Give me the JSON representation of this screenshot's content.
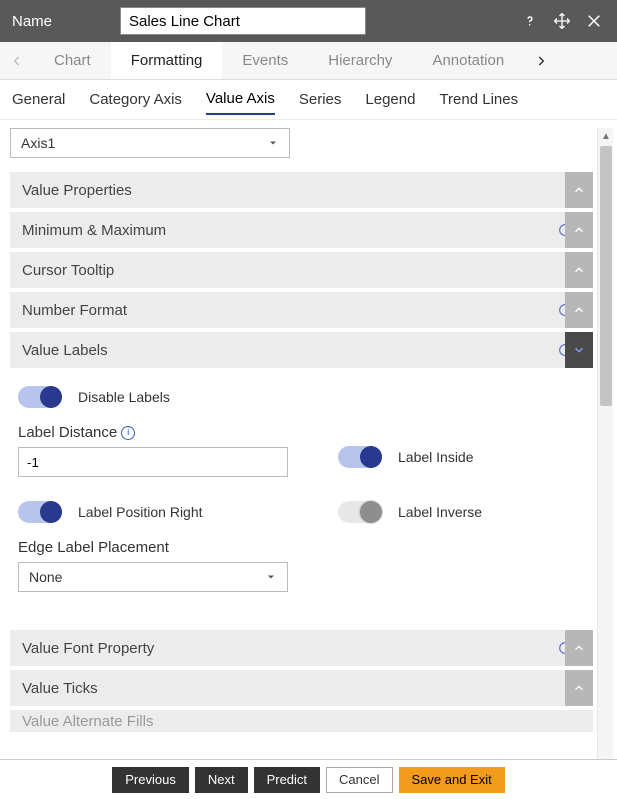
{
  "header": {
    "name_label": "Name",
    "name_value": "Sales Line Chart"
  },
  "primary_tabs": {
    "items": [
      "Chart",
      "Formatting",
      "Events",
      "Hierarchy",
      "Annotation"
    ],
    "active_index": 1
  },
  "sub_tabs": {
    "items": [
      "General",
      "Category Axis",
      "Value Axis",
      "Series",
      "Legend",
      "Trend Lines"
    ],
    "active_index": 2
  },
  "axis_select": {
    "value": "Axis1"
  },
  "accordions": {
    "value_properties": {
      "label": "Value Properties",
      "has_refresh": false,
      "expanded": false
    },
    "minimum_maximum": {
      "label": "Minimum & Maximum",
      "has_refresh": true,
      "expanded": false
    },
    "cursor_tooltip": {
      "label": "Cursor Tooltip",
      "has_refresh": false,
      "expanded": false
    },
    "number_format": {
      "label": "Number Format",
      "has_refresh": true,
      "expanded": false
    },
    "value_labels": {
      "label": "Value Labels",
      "has_refresh": true,
      "expanded": true
    },
    "value_font_property": {
      "label": "Value Font Property",
      "has_refresh": true,
      "expanded": false
    },
    "value_ticks": {
      "label": "Value Ticks",
      "has_refresh": false,
      "expanded": false
    },
    "value_alternate_fills": {
      "label": "Value Alternate Fills",
      "has_refresh": false,
      "expanded": false
    }
  },
  "value_labels_panel": {
    "disable_labels": {
      "label": "Disable Labels",
      "on": true
    },
    "label_distance": {
      "label": "Label Distance",
      "value": "-1"
    },
    "label_inside": {
      "label": "Label Inside",
      "on": true
    },
    "label_position_right": {
      "label": "Label Position Right",
      "on": true
    },
    "label_inverse": {
      "label": "Label Inverse",
      "on": false
    },
    "edge_label_placement": {
      "label": "Edge Label Placement",
      "value": "None"
    }
  },
  "footer": {
    "previous": "Previous",
    "next": "Next",
    "predict": "Predict",
    "cancel": "Cancel",
    "save_exit": "Save and Exit"
  }
}
